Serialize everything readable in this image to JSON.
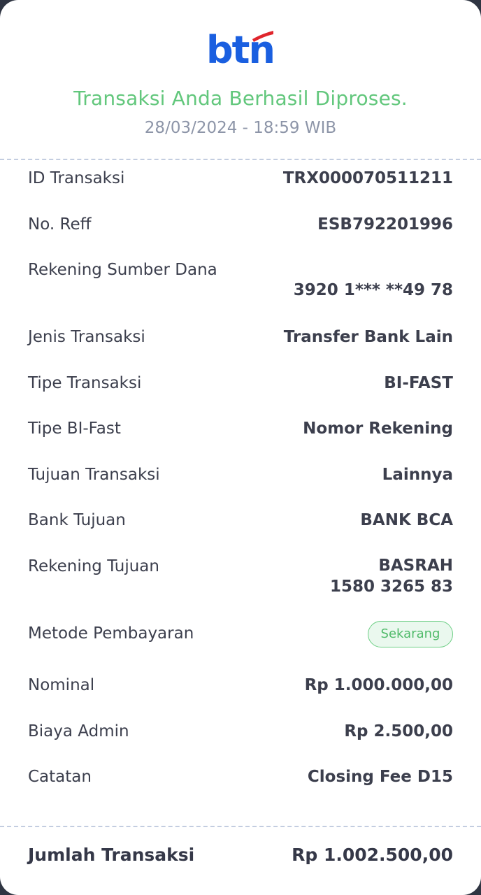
{
  "header": {
    "logo_text": "btn",
    "status_message": "Transaksi Anda Berhasil Diproses.",
    "datetime": "28/03/2024 - 18:59 WIB"
  },
  "details": {
    "id_transaksi": {
      "label": "ID Transaksi",
      "value": "TRX000070511211"
    },
    "no_reff": {
      "label": "No. Reff",
      "value": "ESB792201996"
    },
    "rekening_sumber": {
      "label": "Rekening Sumber Dana",
      "value": "3920 1*** **49 78"
    },
    "jenis_transaksi": {
      "label": "Jenis Transaksi",
      "value": "Transfer Bank Lain"
    },
    "tipe_transaksi": {
      "label": "Tipe Transaksi",
      "value": "BI-FAST"
    },
    "tipe_bifast": {
      "label": "Tipe BI-Fast",
      "value": "Nomor Rekening"
    },
    "tujuan_transaksi": {
      "label": "Tujuan Transaksi",
      "value": "Lainnya"
    },
    "bank_tujuan": {
      "label": "Bank Tujuan",
      "value": "BANK BCA"
    },
    "rekening_tujuan": {
      "label": "Rekening Tujuan",
      "name": "BASRAH",
      "number": "1580 3265 83"
    },
    "metode_pembayaran": {
      "label": "Metode Pembayaran",
      "badge": "Sekarang"
    },
    "nominal": {
      "label": "Nominal",
      "value": "Rp 1.000.000,00"
    },
    "biaya_admin": {
      "label": "Biaya Admin",
      "value": "Rp 2.500,00"
    },
    "catatan": {
      "label": "Catatan",
      "value": "Closing Fee D15"
    }
  },
  "total": {
    "label": "Jumlah Transaksi",
    "value": "Rp 1.002.500,00"
  },
  "colors": {
    "brand_blue": "#1a5fe0",
    "brand_red": "#e0252c",
    "success_green": "#62c77c",
    "text_dark": "#3c3f4d",
    "muted": "#8d95a8"
  }
}
